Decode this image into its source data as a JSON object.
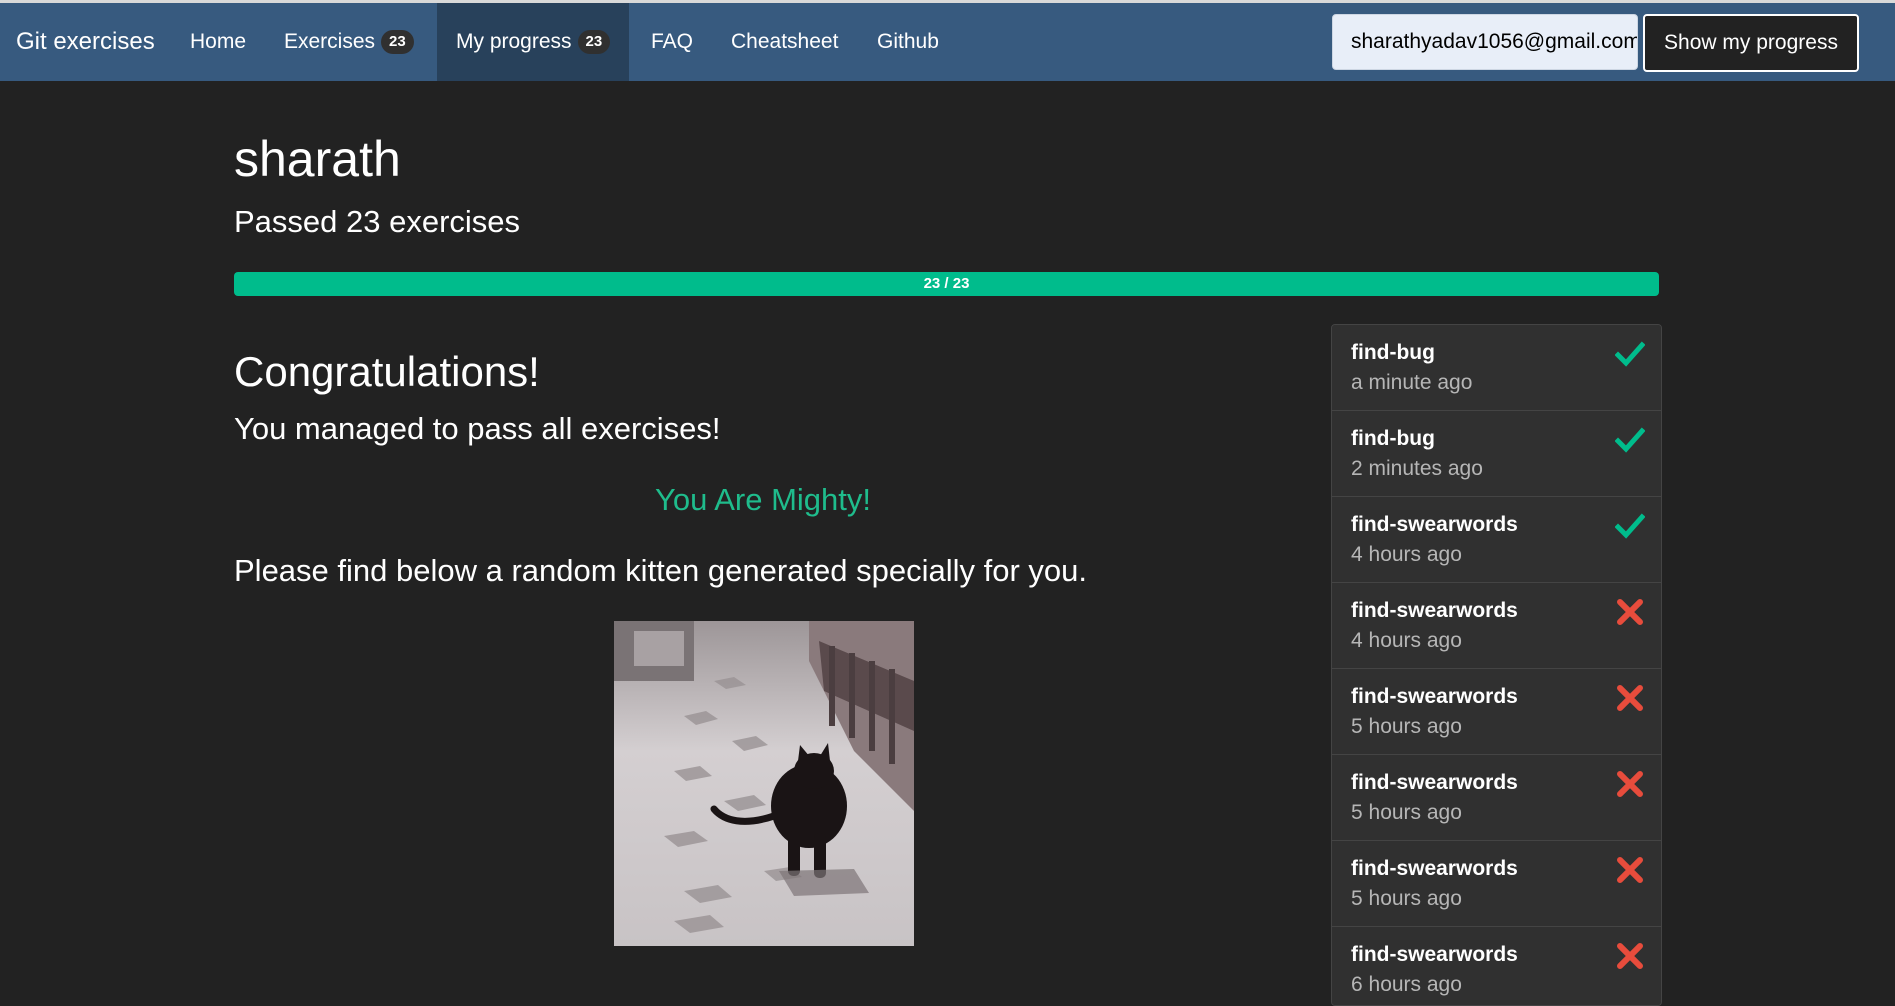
{
  "nav": {
    "brand": "Git exercises",
    "home": "Home",
    "exercises": "Exercises",
    "exercises_count": "23",
    "my_progress": "My progress",
    "my_progress_count": "23",
    "faq": "FAQ",
    "cheatsheet": "Cheatsheet",
    "github": "Github",
    "email_value": "sharathyadav1056@gmail.com",
    "show_progress": "Show my progress"
  },
  "profile": {
    "username": "sharath",
    "passed_text": "Passed 23 exercises",
    "progress_label": "23 / 23",
    "progress_fraction": 1.0
  },
  "content": {
    "congrats": "Congratulations!",
    "managed": "You managed to pass all exercises!",
    "mighty": "You Are Mighty!",
    "kitten_text": "Please find below a random kitten generated specially for you."
  },
  "history": [
    {
      "name": "find-bug",
      "time": "a minute ago",
      "status": "pass"
    },
    {
      "name": "find-bug",
      "time": "2 minutes ago",
      "status": "pass"
    },
    {
      "name": "find-swearwords",
      "time": "4 hours ago",
      "status": "pass"
    },
    {
      "name": "find-swearwords",
      "time": "4 hours ago",
      "status": "fail"
    },
    {
      "name": "find-swearwords",
      "time": "5 hours ago",
      "status": "fail"
    },
    {
      "name": "find-swearwords",
      "time": "5 hours ago",
      "status": "fail"
    },
    {
      "name": "find-swearwords",
      "time": "5 hours ago",
      "status": "fail"
    },
    {
      "name": "find-swearwords",
      "time": "6 hours ago",
      "status": "fail"
    }
  ],
  "colors": {
    "navbar": "#375a7f",
    "success": "#00bc8c",
    "danger": "#e74c3c",
    "background": "#222222"
  },
  "icons": {
    "pass": "check-icon",
    "fail": "x-mark-icon"
  }
}
